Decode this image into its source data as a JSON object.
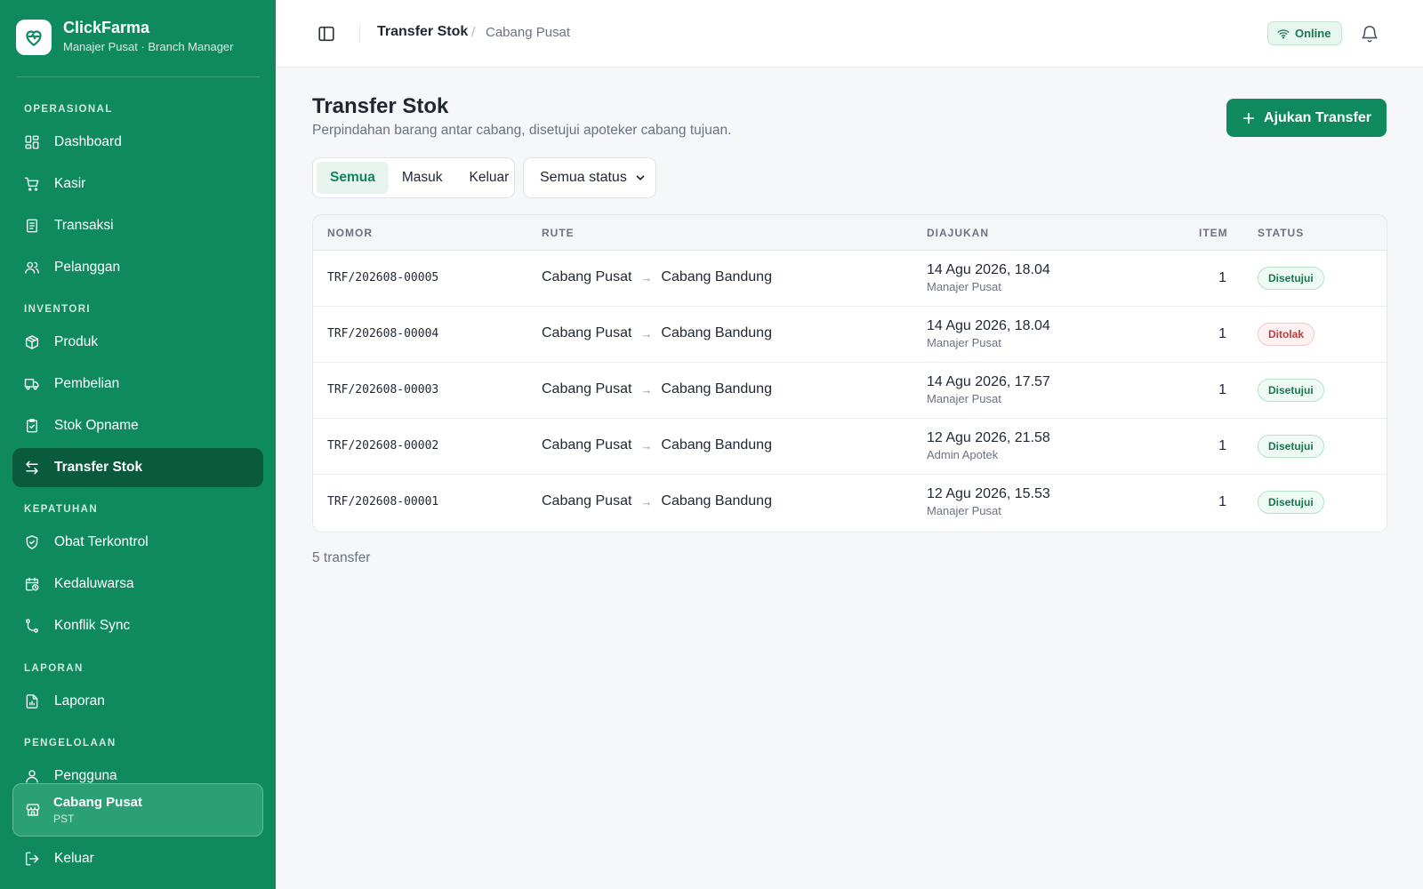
{
  "brand": {
    "name": "ClickFarma",
    "subtitle": "Manajer Pusat · Branch Manager"
  },
  "sidebar": {
    "sections": [
      "OPERASIONAL",
      "INVENTORI",
      "KEPATUHAN",
      "LAPORAN",
      "PENGELOLAAN"
    ],
    "items": [
      {
        "label": "Dashboard",
        "icon": "dashboard-icon"
      },
      {
        "label": "Kasir",
        "icon": "cart-icon"
      },
      {
        "label": "Transaksi",
        "icon": "receipt-icon"
      },
      {
        "label": "Pelanggan",
        "icon": "users-icon"
      },
      {
        "label": "Produk",
        "icon": "package-icon"
      },
      {
        "label": "Pembelian",
        "icon": "truck-icon"
      },
      {
        "label": "Stok Opname",
        "icon": "clipboard-check-icon"
      },
      {
        "label": "Transfer Stok",
        "icon": "transfer-icon",
        "active": true
      },
      {
        "label": "Obat Terkontrol",
        "icon": "shield-icon"
      },
      {
        "label": "Kedaluwarsa",
        "icon": "calendar-clock-icon"
      },
      {
        "label": "Konflik Sync",
        "icon": "git-branch-icon"
      },
      {
        "label": "Laporan",
        "icon": "report-icon"
      },
      {
        "label": "Pengguna",
        "icon": "user-icon"
      }
    ],
    "branch": {
      "name": "Cabang Pusat",
      "code": "PST"
    },
    "logout_label": "Keluar"
  },
  "header": {
    "breadcrumb_main": "Transfer Stok",
    "breadcrumb_sub": "Cabang Pusat",
    "status_label": "Online"
  },
  "main": {
    "title": "Transfer Stok",
    "description": "Perpindahan barang antar cabang, disetujui apoteker cabang tujuan.",
    "primary_button": "Ajukan Transfer",
    "tabs": [
      "Semua",
      "Masuk",
      "Keluar"
    ],
    "active_tab": "Semua",
    "status_filter": "Semua status",
    "columns": [
      "NOMOR",
      "RUTE",
      "DIAJUKAN",
      "ITEM",
      "STATUS"
    ],
    "rows": [
      {
        "no": "TRF/202608-00005",
        "from": "Cabang Pusat",
        "to": "Cabang Bandung",
        "date": "14 Agu 2026, 18.04",
        "by": "Manajer Pusat",
        "items": "1",
        "status": "Disetujui"
      },
      {
        "no": "TRF/202608-00004",
        "from": "Cabang Pusat",
        "to": "Cabang Bandung",
        "date": "14 Agu 2026, 18.04",
        "by": "Manajer Pusat",
        "items": "1",
        "status": "Ditolak"
      },
      {
        "no": "TRF/202608-00003",
        "from": "Cabang Pusat",
        "to": "Cabang Bandung",
        "date": "14 Agu 2026, 17.57",
        "by": "Manajer Pusat",
        "items": "1",
        "status": "Disetujui"
      },
      {
        "no": "TRF/202608-00002",
        "from": "Cabang Pusat",
        "to": "Cabang Bandung",
        "date": "12 Agu 2026, 21.58",
        "by": "Admin Apotek",
        "items": "1",
        "status": "Disetujui"
      },
      {
        "no": "TRF/202608-00001",
        "from": "Cabang Pusat",
        "to": "Cabang Bandung",
        "date": "12 Agu 2026, 15.53",
        "by": "Manajer Pusat",
        "items": "1",
        "status": "Disetujui"
      }
    ],
    "footer_count": "5 transfer"
  },
  "colors": {
    "brand": "#0f8a5f",
    "brand_dark": "#0a5a3e",
    "approved": "#16794f",
    "rejected": "#c33a3a"
  }
}
